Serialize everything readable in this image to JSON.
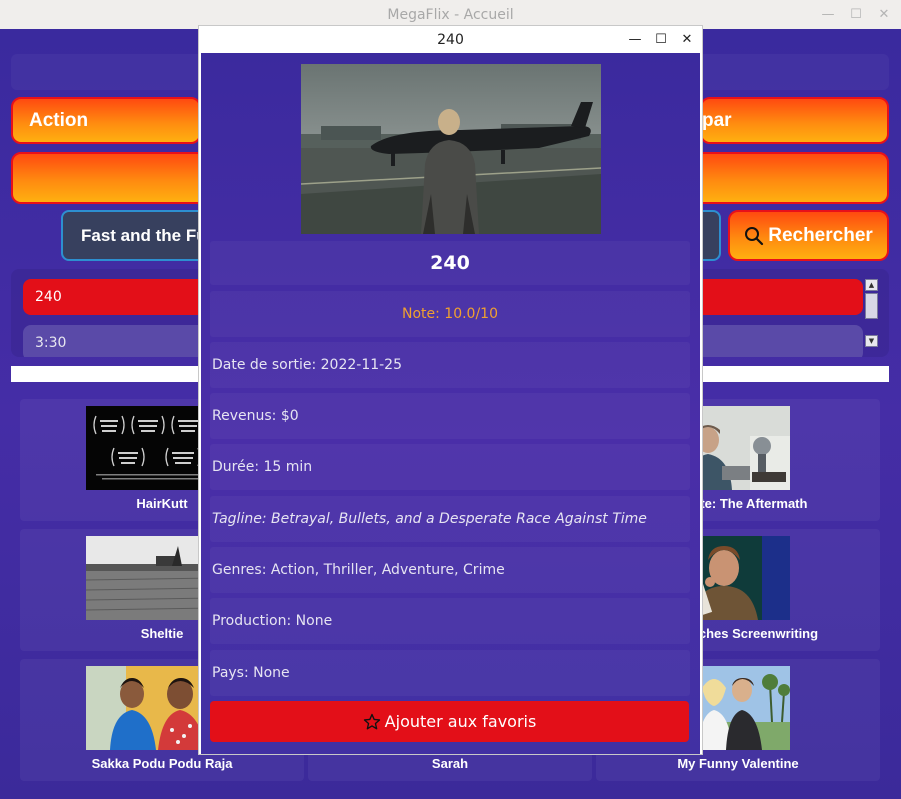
{
  "window": {
    "title": "MegaFlix - Accueil",
    "controls": {
      "minimize": "—",
      "maximize": "☐",
      "close": "✕"
    }
  },
  "filters": {
    "action_label": "Action",
    "par_label": "par",
    "wide_label": ""
  },
  "search": {
    "value": "Fast and the Fur",
    "button_label": "Rechercher"
  },
  "results": {
    "items": [
      {
        "label": "240",
        "selected": true
      },
      {
        "label": "3:30",
        "selected": false
      }
    ]
  },
  "movies": [
    {
      "title": "HairKutt",
      "thumb": "laurels-poster"
    },
    {
      "title": "",
      "thumb": "hidden"
    },
    {
      "title": "Debate: The Aftermath",
      "thumb": "man-seated"
    },
    {
      "title": "Sheltie",
      "thumb": "field-bw"
    },
    {
      "title": "",
      "thumb": "hidden"
    },
    {
      "title": "on Teaches Screenwriting",
      "thumb": "man-reading"
    },
    {
      "title": "Sakka Podu Podu Raja",
      "thumb": "two-men"
    },
    {
      "title": "Sarah",
      "thumb": "hidden"
    },
    {
      "title": "My Funny Valentine",
      "thumb": "couple"
    }
  ],
  "dialog": {
    "window_title": "240",
    "controls": {
      "minimize": "—",
      "maximize": "☐",
      "close": "✕"
    },
    "movie_title": "240",
    "note": "Note: 10.0/10",
    "release": "Date de sortie: 2022-11-25",
    "revenue": "Revenus: $0",
    "duration": "Durée: 15 min",
    "tagline": "Tagline: Betrayal, Bullets, and a Desperate Race Against Time",
    "genres": "Genres: Action, Thriller, Adventure, Crime",
    "production": "Production: None",
    "country": "Pays: None",
    "favorite_label": "Ajouter aux favoris"
  },
  "colors": {
    "background": "#3c2a9c",
    "accent_red": "#e30f18",
    "accent_orange": "#ff8a10",
    "note_color": "#f0a030",
    "search_border": "#2d8fd0"
  },
  "icons": {
    "search": "search-icon",
    "favorite": "star-icon"
  }
}
